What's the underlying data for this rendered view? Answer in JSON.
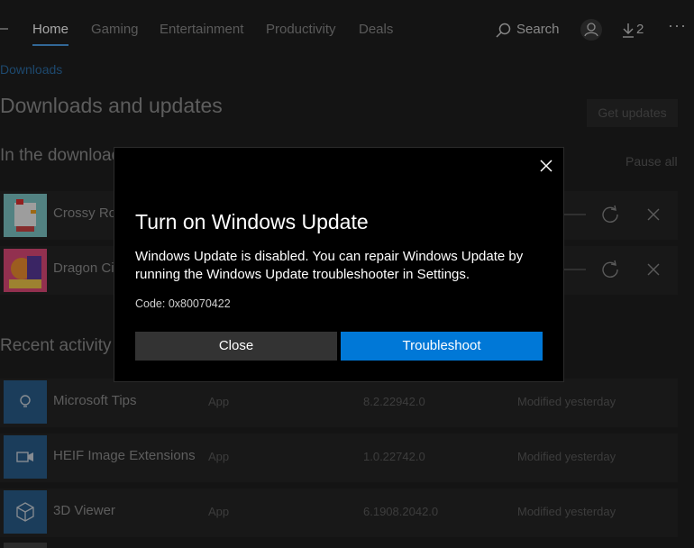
{
  "nav": {
    "tabs": [
      "Home",
      "Gaming",
      "Entertainment",
      "Productivity",
      "Deals"
    ],
    "search_label": "Search",
    "downloads_count": "2"
  },
  "breadcrumb": "Downloads",
  "page_title": "Downloads and updates",
  "get_updates_label": "Get updates",
  "queue": {
    "heading": "In the download queue",
    "pause_all_label": "Pause all",
    "items": [
      {
        "name": "Crossy Road"
      },
      {
        "name": "Dragon City"
      }
    ]
  },
  "recent": {
    "heading": "Recent activity",
    "items": [
      {
        "name": "Microsoft Tips",
        "type": "App",
        "version": "8.2.22942.0",
        "modified": "Modified yesterday",
        "icon": "lightbulb-icon"
      },
      {
        "name": "HEIF Image Extensions",
        "type": "App",
        "version": "1.0.22742.0",
        "modified": "Modified yesterday",
        "icon": "video-icon"
      },
      {
        "name": "3D Viewer",
        "type": "App",
        "version": "6.1908.2042.0",
        "modified": "Modified yesterday",
        "icon": "cube-icon"
      }
    ]
  },
  "dialog": {
    "title": "Turn on Windows Update",
    "message": "Windows Update is disabled. You can repair Windows Update by running the Windows Update troubleshooter in Settings.",
    "code": "Code: 0x80070422",
    "close_label": "Close",
    "troubleshoot_label": "Troubleshoot"
  },
  "colors": {
    "accent": "#0078d7",
    "background": "#1f1f1f",
    "dialog_background": "#000000"
  }
}
